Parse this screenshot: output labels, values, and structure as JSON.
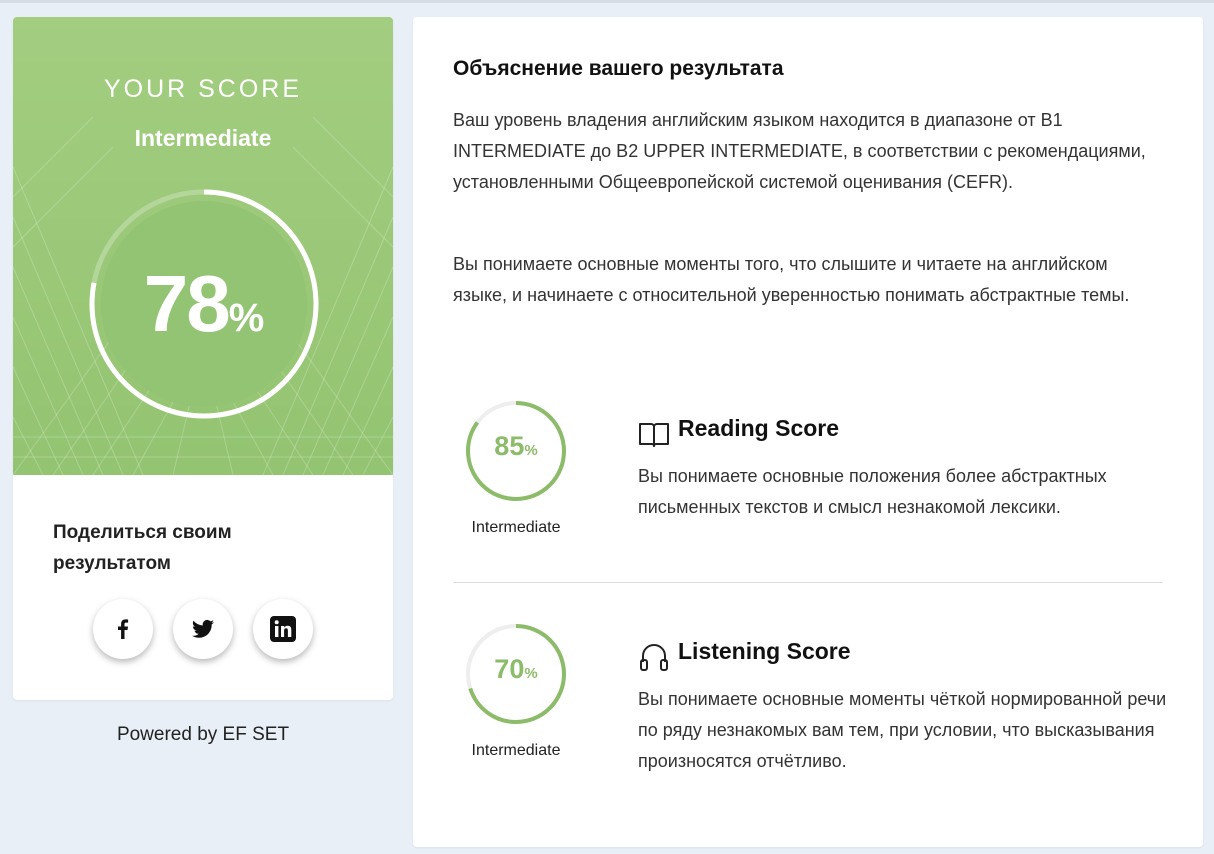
{
  "score_card": {
    "heading": "YOUR SCORE",
    "level": "Intermediate",
    "score": 78,
    "score_text": "78",
    "percent_sign": "%",
    "colors": {
      "hero": "#9cc97a",
      "ring": "#ffffff"
    },
    "share_label": "Поделиться своим результатом",
    "social": [
      {
        "icon": "facebook-icon"
      },
      {
        "icon": "twitter-icon"
      },
      {
        "icon": "linkedin-icon"
      }
    ]
  },
  "footer": {
    "powered_by": "Powered by EF SET"
  },
  "explanation": {
    "title": "Объяснение вашего результата",
    "paragraph1": "Ваш уровень владения английским языком находится в диапазоне от B1 INTERMEDIATE до B2 UPPER INTERMEDIATE, в соответствии с рекомендациями, установленными Общеевропейской системой оценивания (CEFR).",
    "paragraph2": "Вы понимаете основные моменты того, что слышите и читаете на английском языке, и начинаете с относительной уверенностью понимать абстрактные темы."
  },
  "skills": {
    "reading": {
      "title": "Reading Score",
      "icon": "book-icon",
      "score": 85,
      "score_text": "85",
      "percent_sign": "%",
      "level": "Intermediate",
      "description": "Вы понимаете основные положения более абстрактных письменных текстов и смысл незнакомой лексики."
    },
    "listening": {
      "title": "Listening Score",
      "icon": "headphones-icon",
      "score": 70,
      "score_text": "70",
      "percent_sign": "%",
      "level": "Intermediate",
      "description": "Вы понимаете основные моменты чёткой нормированной речи по ряду незнакомых вам тем, при условии, что высказывания произносятся отчётливо."
    }
  },
  "colors": {
    "accent": "#8cbb6a",
    "track": "#eeeeee",
    "background": "#e8eff7"
  }
}
